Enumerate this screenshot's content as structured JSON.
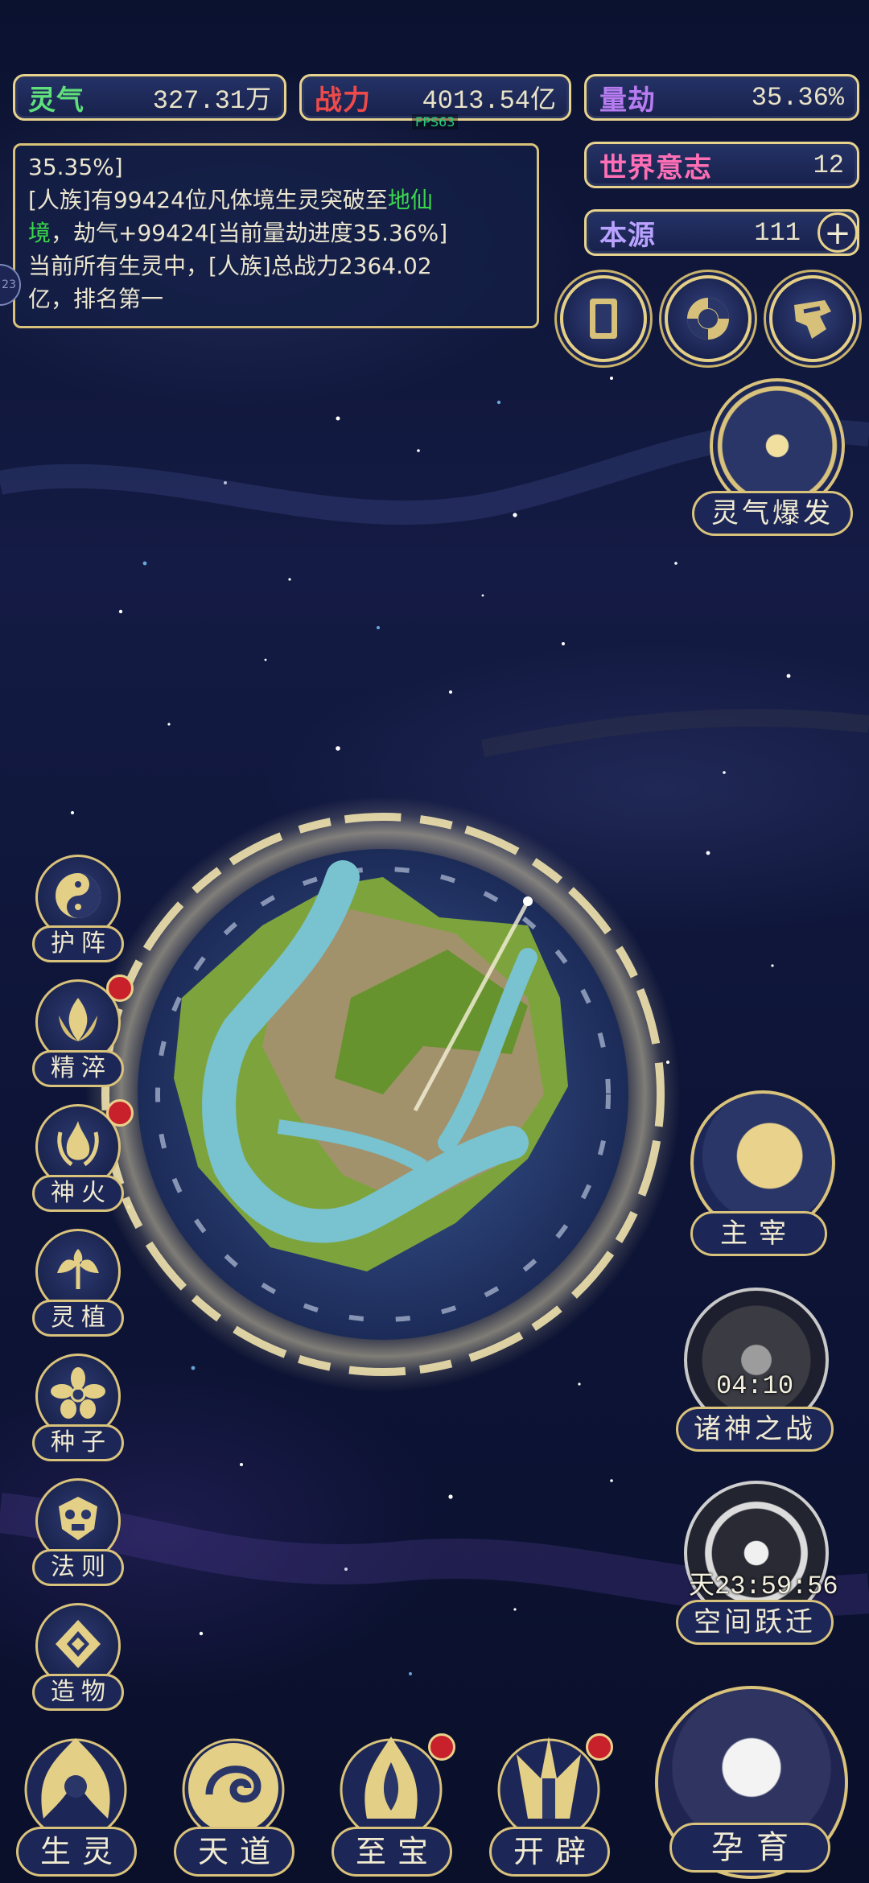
{
  "stats": {
    "lingqi": {
      "label": "灵气",
      "value": "327.31万"
    },
    "zhanli": {
      "label": "战力",
      "value": "4013.54亿"
    },
    "liangjie": {
      "label": "量劫",
      "value": "35.36%"
    },
    "shijie": {
      "label": "世界意志",
      "value": "12"
    },
    "benyuan": {
      "label": "本源",
      "value": "111"
    },
    "fps": "FPS63"
  },
  "log": {
    "line1": "35.35%]",
    "line2a": "[人族]有99424位凡体境生灵突破至",
    "line2b": "地仙",
    "line3a": "境",
    "line3b": "，劫气+99424[当前量劫进度35.36%]",
    "line4": "当前所有生灵中，[人族]总战力2364.02",
    "line5": "亿，排名第一"
  },
  "left_edge_badge": "23",
  "side_menu": [
    {
      "label": "护阵",
      "icon": "yin-yang-icon",
      "badge": false
    },
    {
      "label": "精淬",
      "icon": "flame-lotus-icon",
      "badge": true
    },
    {
      "label": "神火",
      "icon": "divine-fire-icon",
      "badge": true
    },
    {
      "label": "灵植",
      "icon": "spirit-plant-icon",
      "badge": false
    },
    {
      "label": "种子",
      "icon": "flower-seed-icon",
      "badge": false
    },
    {
      "label": "法则",
      "icon": "law-totem-icon",
      "badge": false
    },
    {
      "label": "造物",
      "icon": "creation-diamond-icon",
      "badge": false
    }
  ],
  "right_features": {
    "burst": {
      "label": "灵气爆发"
    },
    "ruler": {
      "label": "主宰"
    },
    "godwar": {
      "label": "诸神之战",
      "timer": "04:10"
    },
    "warp": {
      "label": "空间跃迁",
      "timer": "天23:59:56"
    }
  },
  "bottom_nav": [
    {
      "label": "生灵",
      "badge": false
    },
    {
      "label": "天道",
      "badge": false
    },
    {
      "label": "至宝",
      "badge": true
    },
    {
      "label": "开辟",
      "badge": true
    }
  ],
  "main_action": {
    "label": "孕育"
  },
  "colors": {
    "gold": "#e7d28e",
    "panel": "#1d2757",
    "badge_red": "#c8212b",
    "green_text": "#39d84b"
  }
}
